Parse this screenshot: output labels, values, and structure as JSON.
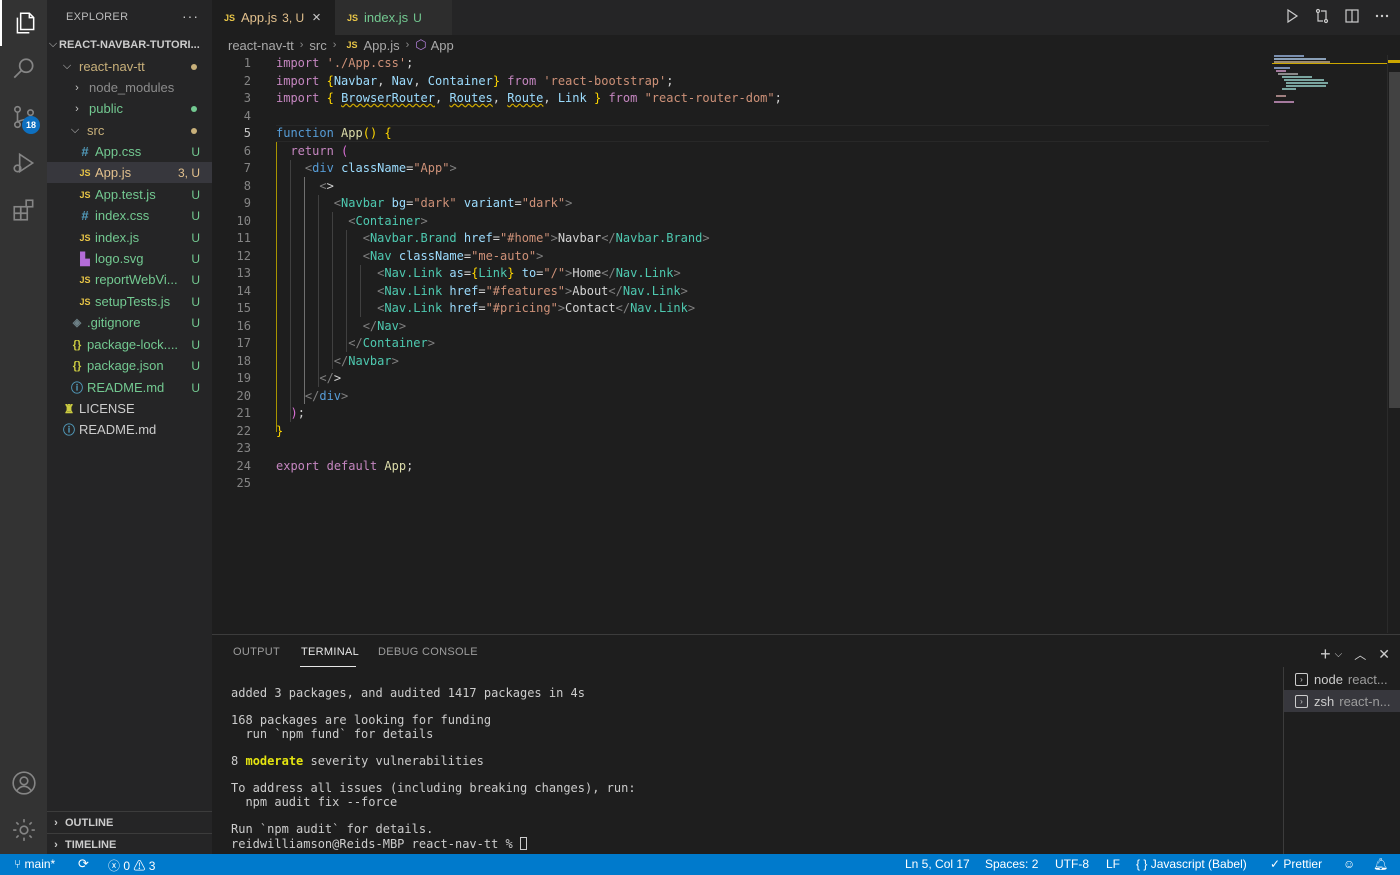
{
  "explorer": {
    "title": "EXPLORER",
    "more": "···",
    "root": "REACT-NAVBAR-TUTORI...",
    "items": [
      {
        "name": "react-nav-tt",
        "status": "",
        "type": "folder"
      },
      {
        "name": "node_modules",
        "status": "",
        "type": "folder"
      },
      {
        "name": "public",
        "status": "",
        "type": "folder"
      },
      {
        "name": "src",
        "status": "",
        "type": "folder"
      },
      {
        "name": "App.css",
        "status": "U",
        "icon": "#"
      },
      {
        "name": "App.js",
        "status": "3, U",
        "icon": "JS"
      },
      {
        "name": "App.test.js",
        "status": "U",
        "icon": "JS"
      },
      {
        "name": "index.css",
        "status": "U",
        "icon": "#"
      },
      {
        "name": "index.js",
        "status": "U",
        "icon": "JS"
      },
      {
        "name": "logo.svg",
        "status": "U",
        "icon": "svg"
      },
      {
        "name": "reportWebVi...",
        "status": "U",
        "icon": "JS"
      },
      {
        "name": "setupTests.js",
        "status": "U",
        "icon": "JS"
      },
      {
        "name": ".gitignore",
        "status": "U",
        "icon": "git"
      },
      {
        "name": "package-lock....",
        "status": "U",
        "icon": "{}"
      },
      {
        "name": "package.json",
        "status": "U",
        "icon": "{}"
      },
      {
        "name": "README.md",
        "status": "U",
        "icon": "i"
      },
      {
        "name": "LICENSE",
        "status": "",
        "icon": "license"
      },
      {
        "name": "README.md",
        "status": "",
        "icon": "i"
      }
    ],
    "outline": "OUTLINE",
    "timeline": "TIMELINE"
  },
  "activity": {
    "scm_badge": "18",
    "icons": [
      "files-icon",
      "search-icon",
      "source-control-icon",
      "run-debug-icon",
      "extensions-icon",
      "account-icon",
      "settings-gear-icon"
    ]
  },
  "tabs": [
    {
      "badge": "JS",
      "label": "App.js",
      "status": "3, U",
      "close": "×"
    },
    {
      "badge": "JS",
      "label": "index.js",
      "status": "U"
    }
  ],
  "breadcrumb": {
    "parts": [
      "react-nav-tt",
      "src",
      "App.js",
      "App"
    ],
    "file_badge": "JS"
  },
  "editor": {
    "line_numbers": [
      "1",
      "2",
      "3",
      "4",
      "5",
      "6",
      "7",
      "8",
      "9",
      "10",
      "11",
      "12",
      "13",
      "14",
      "15",
      "16",
      "17",
      "18",
      "19",
      "20",
      "21",
      "22",
      "23",
      "24",
      "25"
    ],
    "current_line": "5"
  },
  "panel": {
    "tabs": [
      "OUTPUT",
      "TERMINAL",
      "DEBUG CONSOLE"
    ],
    "active_tab": "TERMINAL",
    "terminal_lines": [
      "added 3 packages, and audited 1417 packages in 4s",
      "",
      "168 packages are looking for funding",
      "  run `npm fund` for details",
      "",
      "8 moderate severity vulnerabilities",
      "",
      "To address all issues (including breaking changes), run:",
      "  npm audit fix --force",
      "",
      "Run `npm audit` for details.",
      "reidwilliamson@Reids-MBP react-nav-tt % "
    ],
    "vuln_count": "8",
    "vuln_word": "moderate",
    "vuln_rest": " severity vulnerabilities",
    "terminals": [
      {
        "name": "node",
        "desc": "react..."
      },
      {
        "name": "zsh",
        "desc": "react-n..."
      }
    ]
  },
  "statusbar": {
    "branch": "main*",
    "errors": "0",
    "warnings": "3",
    "position": "Ln 5, Col 17",
    "spaces": "Spaces: 2",
    "encoding": "UTF-8",
    "eol": "LF",
    "language": "Javascript (Babel)",
    "formatter": "Prettier",
    "brackets": "{ }"
  },
  "colors": {
    "accent": "#007acc",
    "untracked": "#73c991",
    "modified": "#e2c08d",
    "warning": "#cca700"
  }
}
